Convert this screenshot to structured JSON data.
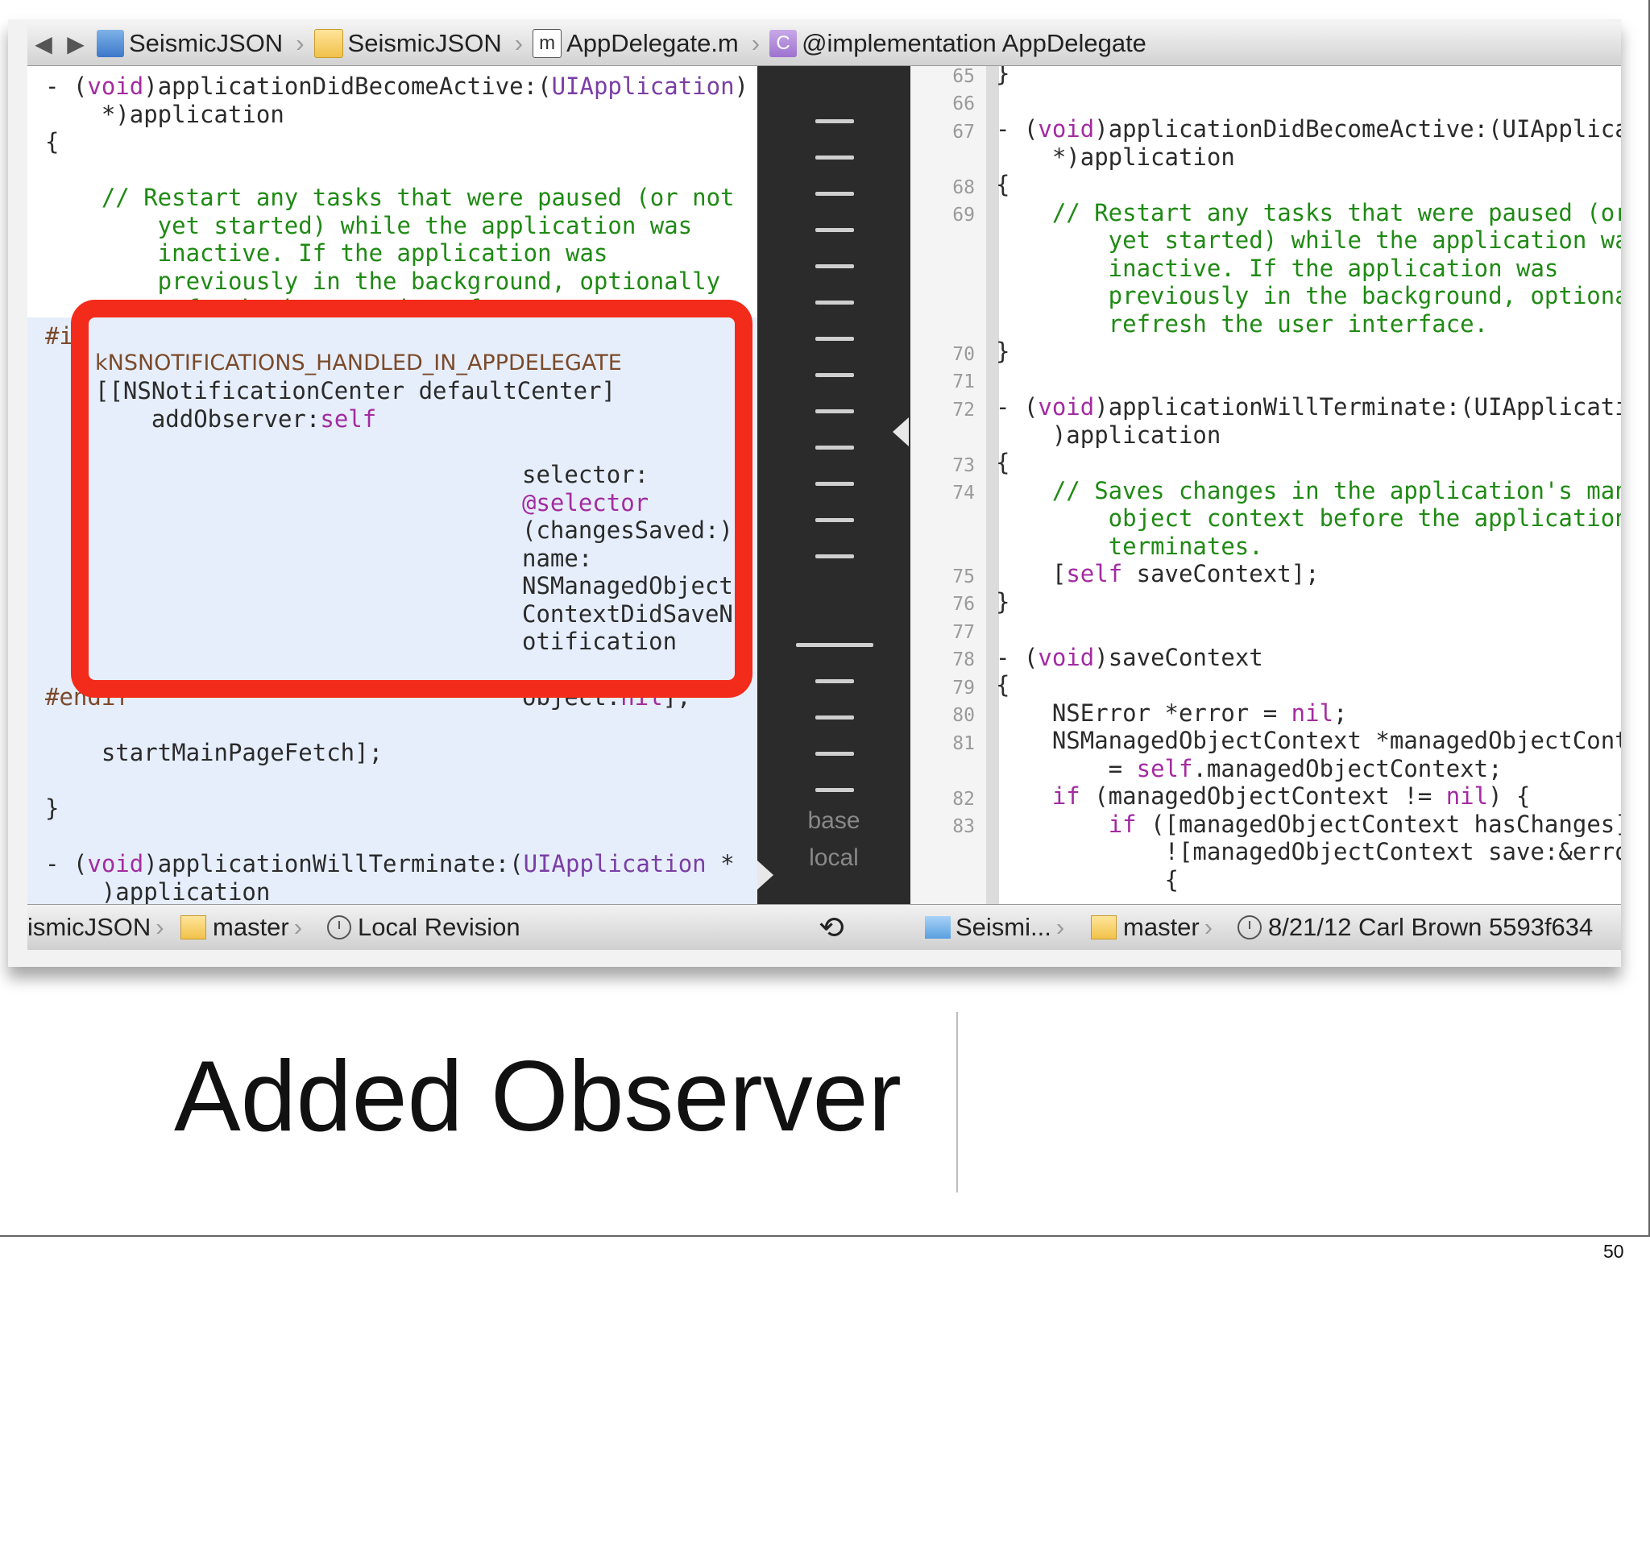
{
  "jumpbar": {
    "nav_back": "◀",
    "nav_forward": "▶",
    "crumbs": [
      "SeismicJSON",
      "SeismicJSON",
      "AppDelegate.m",
      "@implementation AppDelegate"
    ],
    "icon_m": "m",
    "icon_c": "C"
  },
  "left_code": {
    "l1a": "- (",
    "l1kw": "void",
    "l1b": ")applicationDidBecomeActive:(",
    "l1cls": "UIApplication",
    "l1c": ")",
    "l2": "    *)application",
    "l3": "{",
    "c1": "    // Restart any tasks that were paused (or not",
    "c2": "        yet started) while the application was",
    "c3": "        inactive. If the application was",
    "c4": "        previously in the background, optionally",
    "c5": "        refresh the user interface.",
    "if_prefix": "#if",
    "macro": "kNSNOTIFICATIONS_HANDLED_IN_APPDELEGATE",
    "nc": "[[NSNotificationCenter defaultCenter]",
    "add_a": "    addObserver:",
    "add_self": "self",
    "sel1": "selector:",
    "sel2": "@selector",
    "sel3": "(changesSaved:)",
    "sel4": "name:",
    "sel5": "NSManagedObject",
    "sel6": "ContextDidSaveN",
    "sel7": "otification",
    "obj_a": "object:",
    "obj_nil": "nil",
    "obj_b": "];",
    "endif": "#endif",
    "fetch": "    startMainPageFetch];",
    "close": "}",
    "last_a": "- (",
    "last_kw": "void",
    "last_b": ")applicationWillTerminate:(",
    "last_cls": "UIApplication",
    "last_c": " *",
    "last2": "    )application"
  },
  "comparison": {
    "label_base": "base",
    "label_local": "local"
  },
  "right_code": {
    "line_numbers": [
      "65",
      "66",
      "67",
      "68",
      "69",
      "70",
      "71",
      "72",
      "73",
      "74",
      "75",
      "76",
      "77",
      "78",
      "79",
      "80",
      "81",
      "82",
      "83"
    ],
    "r1": "}",
    "r2a": "- (",
    "r2kw": "void",
    "r2b": ")applicationDidBecomeActive:(UIApplica",
    "r3": "    *)application",
    "r4": "{",
    "r5": "    // Restart any tasks that were paused (or",
    "r6": "        yet started) while the application wa",
    "r7": "        inactive. If the application was",
    "r8": "        previously in the background, optiona",
    "r9": "        refresh the user interface.",
    "r10": "}",
    "r11a": "- (",
    "r11kw": "void",
    "r11b": ")applicationWillTerminate:(UIApplicati",
    "r12": "    )application",
    "r13": "{",
    "r14": "    // Saves changes in the application's man",
    "r15": "        object context before the application",
    "r16": "        terminates.",
    "r17a": "    [",
    "r17kw": "self",
    "r17b": " saveContext];",
    "r18": "}",
    "r19a": "- (",
    "r19kw": "void",
    "r19b": ")saveContext",
    "r20": "{",
    "r21a": "    NSError *error = ",
    "r21nil": "nil",
    "r21b": ";",
    "r22": "    NSManagedObjectContext *managedObjectCont",
    "r23a": "        = ",
    "r23kw": "self",
    "r23b": ".managedObjectContext;",
    "r24a": "    ",
    "r24kw": "if",
    "r24b": " (managedObjectContext != ",
    "r24nil": "nil",
    "r24c": ") {",
    "r25a": "        ",
    "r25kw": "if",
    "r25b": " ([managedObjectContext hasChanges]",
    "r26": "            ![managedObjectContext save:&erro",
    "r27": "            {"
  },
  "bottombar": {
    "left_project": "ismicJSON",
    "left_branch": "master",
    "left_revision": "Local Revision",
    "history_icon": "⟲",
    "right_project": "Seismi...",
    "right_branch": "master",
    "right_revision": "8/21/12  Carl Brown  5593f634"
  },
  "slide": {
    "title": "Added Observer",
    "page_number": "50"
  }
}
